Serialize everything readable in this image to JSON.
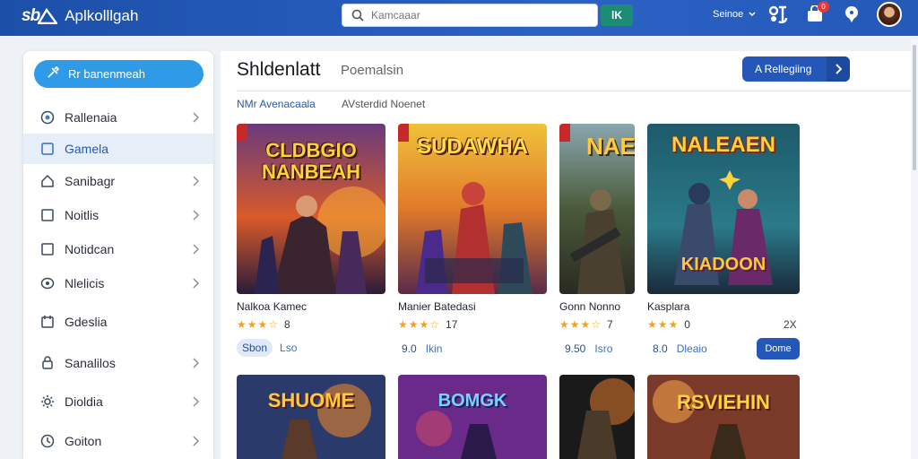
{
  "app": {
    "logo_mark": "sb",
    "title": "Aplkolllgah"
  },
  "search": {
    "placeholder": "Kamcaaar",
    "go_label": "lK"
  },
  "header": {
    "user_label": "Seinoe"
  },
  "notifications": {
    "count": "0"
  },
  "icons": [
    "search-icon",
    "gamepad-icon",
    "cart-icon",
    "chat-icon",
    "chevron-right-icon",
    "shield-icon",
    "square-icon",
    "home-icon",
    "bell-icon",
    "settings-icon"
  ],
  "colors": {
    "topbar": "#2559b8",
    "accent": "#2f9be8",
    "primary_button": "#2457b8",
    "star": "#f2a21a",
    "search_go": "#1d8c74"
  },
  "sidebar": {
    "primary": {
      "label": "Rr banenmeah"
    },
    "items": [
      {
        "label": "Rallenaia",
        "icon": "shield-icon",
        "chevron": true
      },
      {
        "label": "Gamela",
        "icon": "square-icon",
        "chevron": false,
        "active": true
      },
      {
        "label": "Sanibagr",
        "icon": "home-icon",
        "chevron": true
      },
      {
        "label": "Noitlis",
        "icon": "square-icon",
        "chevron": true
      },
      {
        "label": "Notidcan",
        "icon": "square-icon",
        "chevron": true
      },
      {
        "label": "Nlelicis",
        "icon": "shield-icon",
        "chevron": true
      },
      {
        "label": "Gdeslia",
        "icon": "calendar-icon",
        "chevron": false
      },
      {
        "label": "Sanalilos",
        "icon": "lock-icon",
        "chevron": true
      },
      {
        "label": "Dioldia",
        "icon": "settings-icon",
        "chevron": true
      },
      {
        "label": "Goiton",
        "icon": "clock-icon",
        "chevron": true
      }
    ]
  },
  "main": {
    "title": "Shldenlatt",
    "subtitle": "Poemalsin",
    "cta_label": "A  Rellegiing",
    "tabs": [
      {
        "label": "NMr Avenacaala"
      },
      {
        "label": "AVsterdid Noenet"
      }
    ]
  },
  "games": [
    {
      "art_title": "CLDBGIO NANBEAH",
      "name": "Nalkoa Kamec",
      "rating": "★★★☆",
      "score": "8",
      "price": "Sbon",
      "secondary": "Lso"
    },
    {
      "art_title": "SUDAWHA",
      "name": "Manier Batedasi",
      "rating": "★★★☆",
      "score": "17",
      "price": "9.0",
      "secondary": "Ikin"
    },
    {
      "art_title": "NAE",
      "name": "Gonn Nonno",
      "rating": "★★★☆",
      "score": "7",
      "price": "9.50",
      "secondary": "Isro"
    },
    {
      "art_title": "NALEAEN",
      "name": "Kasplara",
      "rating": "★★★",
      "score": "0",
      "price": "8.0",
      "secondary": "Dleaio",
      "extra": "2X",
      "action": "Dome"
    }
  ],
  "games_row2": [
    {
      "art_title": "SHUOME"
    },
    {
      "art_title": "BOMGK"
    },
    {
      "art_title": ""
    },
    {
      "art_title": "RSVIEHIN"
    }
  ]
}
